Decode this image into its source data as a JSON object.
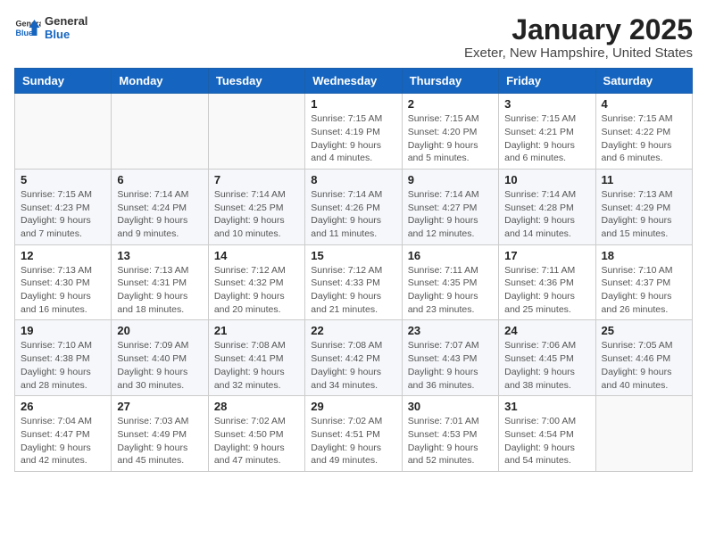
{
  "header": {
    "logo_line1": "General",
    "logo_line2": "Blue",
    "month_title": "January 2025",
    "location": "Exeter, New Hampshire, United States"
  },
  "weekdays": [
    "Sunday",
    "Monday",
    "Tuesday",
    "Wednesday",
    "Thursday",
    "Friday",
    "Saturday"
  ],
  "weeks": [
    [
      {
        "day": "",
        "info": ""
      },
      {
        "day": "",
        "info": ""
      },
      {
        "day": "",
        "info": ""
      },
      {
        "day": "1",
        "info": "Sunrise: 7:15 AM\nSunset: 4:19 PM\nDaylight: 9 hours\nand 4 minutes."
      },
      {
        "day": "2",
        "info": "Sunrise: 7:15 AM\nSunset: 4:20 PM\nDaylight: 9 hours\nand 5 minutes."
      },
      {
        "day": "3",
        "info": "Sunrise: 7:15 AM\nSunset: 4:21 PM\nDaylight: 9 hours\nand 6 minutes."
      },
      {
        "day": "4",
        "info": "Sunrise: 7:15 AM\nSunset: 4:22 PM\nDaylight: 9 hours\nand 6 minutes."
      }
    ],
    [
      {
        "day": "5",
        "info": "Sunrise: 7:15 AM\nSunset: 4:23 PM\nDaylight: 9 hours\nand 7 minutes."
      },
      {
        "day": "6",
        "info": "Sunrise: 7:14 AM\nSunset: 4:24 PM\nDaylight: 9 hours\nand 9 minutes."
      },
      {
        "day": "7",
        "info": "Sunrise: 7:14 AM\nSunset: 4:25 PM\nDaylight: 9 hours\nand 10 minutes."
      },
      {
        "day": "8",
        "info": "Sunrise: 7:14 AM\nSunset: 4:26 PM\nDaylight: 9 hours\nand 11 minutes."
      },
      {
        "day": "9",
        "info": "Sunrise: 7:14 AM\nSunset: 4:27 PM\nDaylight: 9 hours\nand 12 minutes."
      },
      {
        "day": "10",
        "info": "Sunrise: 7:14 AM\nSunset: 4:28 PM\nDaylight: 9 hours\nand 14 minutes."
      },
      {
        "day": "11",
        "info": "Sunrise: 7:13 AM\nSunset: 4:29 PM\nDaylight: 9 hours\nand 15 minutes."
      }
    ],
    [
      {
        "day": "12",
        "info": "Sunrise: 7:13 AM\nSunset: 4:30 PM\nDaylight: 9 hours\nand 16 minutes."
      },
      {
        "day": "13",
        "info": "Sunrise: 7:13 AM\nSunset: 4:31 PM\nDaylight: 9 hours\nand 18 minutes."
      },
      {
        "day": "14",
        "info": "Sunrise: 7:12 AM\nSunset: 4:32 PM\nDaylight: 9 hours\nand 20 minutes."
      },
      {
        "day": "15",
        "info": "Sunrise: 7:12 AM\nSunset: 4:33 PM\nDaylight: 9 hours\nand 21 minutes."
      },
      {
        "day": "16",
        "info": "Sunrise: 7:11 AM\nSunset: 4:35 PM\nDaylight: 9 hours\nand 23 minutes."
      },
      {
        "day": "17",
        "info": "Sunrise: 7:11 AM\nSunset: 4:36 PM\nDaylight: 9 hours\nand 25 minutes."
      },
      {
        "day": "18",
        "info": "Sunrise: 7:10 AM\nSunset: 4:37 PM\nDaylight: 9 hours\nand 26 minutes."
      }
    ],
    [
      {
        "day": "19",
        "info": "Sunrise: 7:10 AM\nSunset: 4:38 PM\nDaylight: 9 hours\nand 28 minutes."
      },
      {
        "day": "20",
        "info": "Sunrise: 7:09 AM\nSunset: 4:40 PM\nDaylight: 9 hours\nand 30 minutes."
      },
      {
        "day": "21",
        "info": "Sunrise: 7:08 AM\nSunset: 4:41 PM\nDaylight: 9 hours\nand 32 minutes."
      },
      {
        "day": "22",
        "info": "Sunrise: 7:08 AM\nSunset: 4:42 PM\nDaylight: 9 hours\nand 34 minutes."
      },
      {
        "day": "23",
        "info": "Sunrise: 7:07 AM\nSunset: 4:43 PM\nDaylight: 9 hours\nand 36 minutes."
      },
      {
        "day": "24",
        "info": "Sunrise: 7:06 AM\nSunset: 4:45 PM\nDaylight: 9 hours\nand 38 minutes."
      },
      {
        "day": "25",
        "info": "Sunrise: 7:05 AM\nSunset: 4:46 PM\nDaylight: 9 hours\nand 40 minutes."
      }
    ],
    [
      {
        "day": "26",
        "info": "Sunrise: 7:04 AM\nSunset: 4:47 PM\nDaylight: 9 hours\nand 42 minutes."
      },
      {
        "day": "27",
        "info": "Sunrise: 7:03 AM\nSunset: 4:49 PM\nDaylight: 9 hours\nand 45 minutes."
      },
      {
        "day": "28",
        "info": "Sunrise: 7:02 AM\nSunset: 4:50 PM\nDaylight: 9 hours\nand 47 minutes."
      },
      {
        "day": "29",
        "info": "Sunrise: 7:02 AM\nSunset: 4:51 PM\nDaylight: 9 hours\nand 49 minutes."
      },
      {
        "day": "30",
        "info": "Sunrise: 7:01 AM\nSunset: 4:53 PM\nDaylight: 9 hours\nand 52 minutes."
      },
      {
        "day": "31",
        "info": "Sunrise: 7:00 AM\nSunset: 4:54 PM\nDaylight: 9 hours\nand 54 minutes."
      },
      {
        "day": "",
        "info": ""
      }
    ]
  ]
}
